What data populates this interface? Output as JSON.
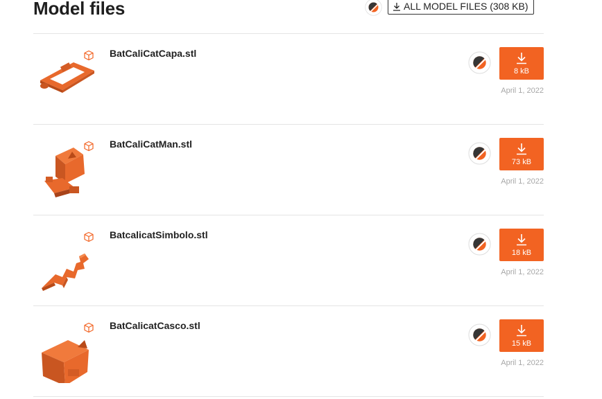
{
  "section": {
    "title": "Model files",
    "all_files_label": "ALL MODEL FILES (308 KB)",
    "slicer_icon": "prusaslicer-logo-icon",
    "download_icon": "download-arrow-icon"
  },
  "files": [
    {
      "name": "BatCaliCatCapa.stl",
      "size": "8 kB",
      "date": "April 1, 2022",
      "thumb": "orange-frame-model-thumbnail"
    },
    {
      "name": "BatCaliCatMan.stl",
      "size": "73 kB",
      "date": "April 1, 2022",
      "thumb": "orange-cat-figure-thumbnail"
    },
    {
      "name": "BatcalicatSimbolo.stl",
      "size": "18 kB",
      "date": "April 1, 2022",
      "thumb": "orange-bat-symbol-thumbnail"
    },
    {
      "name": "BatCalicatCasco.stl",
      "size": "15 kB",
      "date": "April 1, 2022",
      "thumb": "orange-helmet-cube-thumbnail"
    }
  ],
  "colors": {
    "accent": "#f26322",
    "model_orange": "#e8692c",
    "date_gray": "#a7a7a7",
    "divider": "#e4e4e4",
    "slicer_dark": "#363636"
  }
}
